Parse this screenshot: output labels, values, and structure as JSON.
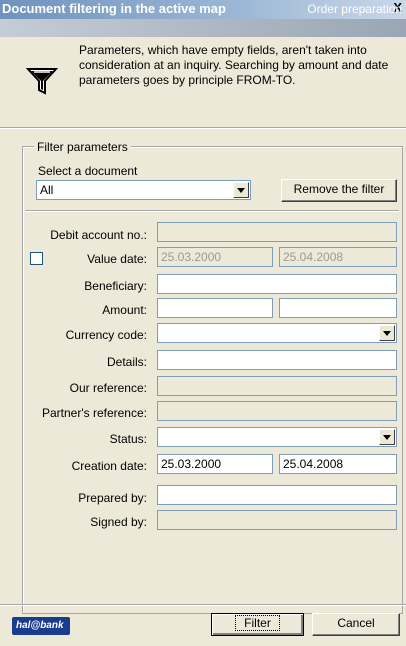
{
  "window": {
    "title": "Document filtering in the active map",
    "close_glyph": "X",
    "subtitle": "Order preparation"
  },
  "info": {
    "icon": "funnel-icon",
    "text": "Parameters, which have empty fields, aren't taken into consideration at an inquiry. Searching by amount and date parameters goes by principle FROM-TO."
  },
  "filter": {
    "group_title": "Filter parameters",
    "select_document_label": "Select a document",
    "document_value": "All",
    "remove_filter_label": "Remove the filter"
  },
  "fields": {
    "debit_account": {
      "label": "Debit account no.:",
      "value": ""
    },
    "value_date": {
      "label": "Value date:",
      "checked": false,
      "from": "25.03.2000",
      "to": "25.04.2008"
    },
    "beneficiary": {
      "label": "Beneficiary:",
      "value": ""
    },
    "amount": {
      "label": "Amount:",
      "from": "",
      "to": ""
    },
    "currency_code": {
      "label": "Currency code:",
      "value": ""
    },
    "details": {
      "label": "Details:",
      "value": ""
    },
    "our_reference": {
      "label": "Our reference:",
      "value": ""
    },
    "partner_reference": {
      "label": "Partner's reference:",
      "value": ""
    },
    "status": {
      "label": "Status:",
      "value": ""
    },
    "creation_date": {
      "label": "Creation date:",
      "from": "25.03.2000",
      "to": "25.04.2008"
    },
    "prepared_by": {
      "label": "Prepared by:",
      "value": ""
    },
    "signed_by": {
      "label": "Signed by:",
      "value": ""
    }
  },
  "footer": {
    "logo_text": "hal@bank",
    "filter_label": "Filter",
    "cancel_label": "Cancel"
  },
  "colors": {
    "titlebar": "#6f93bd",
    "logo_bg": "#1a3c8c",
    "dialog_bg": "#ece9d8"
  }
}
